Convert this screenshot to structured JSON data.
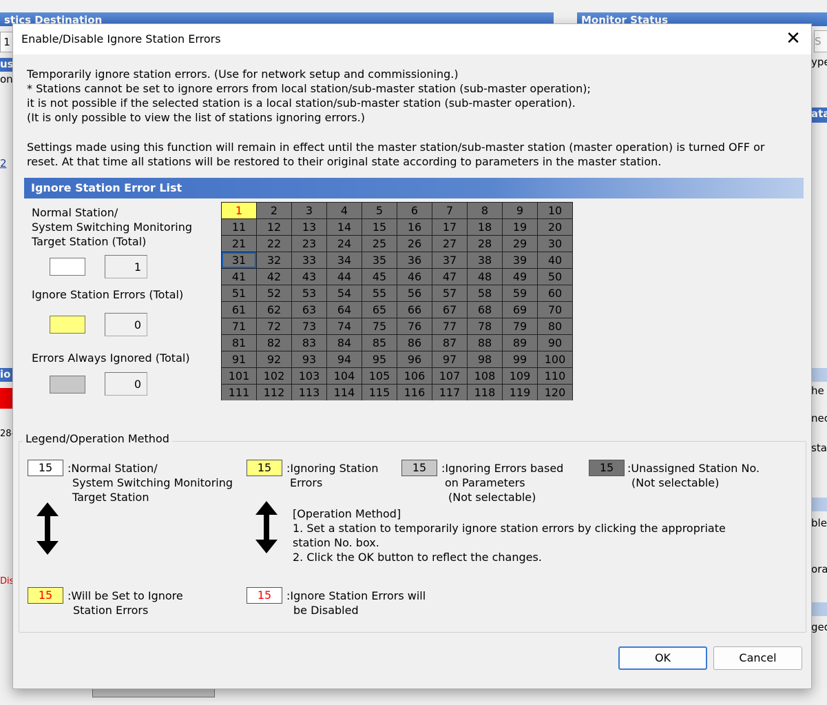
{
  "background": {
    "left_panel_title": "stics Destination",
    "right_panel_title": "Monitor Status",
    "frag_1": "1",
    "frag_us": "us",
    "frag_on": "on",
    "frag_ype": "ype",
    "frag_ata": "ata",
    "frag_2": "2",
    "frag_io": "io",
    "frag_28": "28-",
    "frag_disc": "Disc",
    "frag_he": "he",
    "frag_nec": "nec",
    "frag_sta": "sta",
    "frag_ble": "ble",
    "frag_ora": "ora",
    "frag_ged": "ged",
    "frag_s": "S"
  },
  "dialog": {
    "title": "Enable/Disable Ignore Station Errors",
    "close_glyph": "✕",
    "description": [
      "Temporarily ignore station errors. (Use for network setup and commissioning.)",
      "* Stations cannot be set to ignore errors from local station/sub-master station (sub-master operation);",
      "it is not possible if the selected station is a local station/sub-master station (sub-master operation).",
      "(It is only possible to view the list of stations ignoring errors.)"
    ],
    "note": [
      "Settings made using this function will remain in effect until the master station/sub-master station (master operation) is turned OFF or",
      "reset. At that time all stations will be restored to their original state according to parameters in the master station."
    ],
    "list_header": "Ignore Station Error List",
    "summary": {
      "normal_label": [
        "Normal Station/",
        "System Switching Monitoring",
        "Target Station (Total)"
      ],
      "normal_total": "1",
      "ignore_label": "Ignore Station Errors (Total)",
      "ignore_total": "0",
      "always_label": "Errors Always Ignored (Total)",
      "always_total": "0"
    },
    "stations": {
      "count": 120,
      "normal_stations": [
        1
      ],
      "focused_station": 31
    },
    "legend": {
      "title": "Legend/Operation Method",
      "sample_number": "15",
      "normal": [
        "Normal Station/",
        "System Switching Monitoring",
        "Target Station"
      ],
      "ignoring": [
        "Ignoring Station",
        "Errors"
      ],
      "param": [
        "Ignoring Errors based",
        "on Parameters",
        "(Not selectable)"
      ],
      "unassigned": [
        "Unassigned Station No.",
        "(Not selectable)"
      ],
      "will_set": [
        "Will be Set to Ignore",
        "Station Errors"
      ],
      "will_disable": [
        "Ignore Station Errors will",
        "be Disabled"
      ],
      "operation": [
        "[Operation Method]",
        "1. Set a station to temporarily ignore station errors by clicking the appropriate",
        "station No. box.",
        "2. Click the OK button to reflect the changes."
      ]
    },
    "ok_label": "OK",
    "cancel_label": "Cancel"
  },
  "colors": {
    "normal": "#ffffff",
    "ignoring": "#ffff80",
    "param": "#c8c8c8",
    "unassigned": "#737373",
    "red_text": "#ff0000"
  }
}
